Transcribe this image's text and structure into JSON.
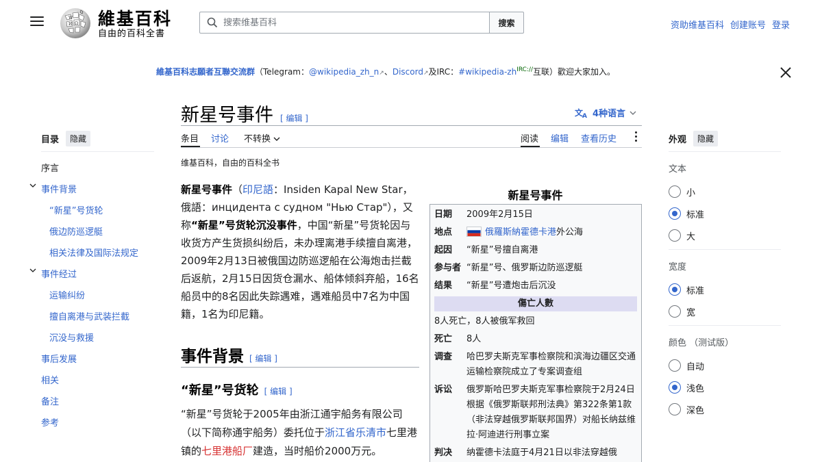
{
  "header": {
    "wordmark": "維基百科",
    "tagline": "自由的百科全書",
    "search_placeholder": "搜索维基百科",
    "search_button": "搜索",
    "user_links": [
      "资助维基百科",
      "创建账号",
      "登录"
    ]
  },
  "sitenotice": {
    "title": "維基百科志願者互聯交流群",
    "open_paren": "（Telegram：",
    "telegram": "@wikipedia_zh_n",
    "sep1": "、",
    "discord": "Discord",
    "sep2": "及IRC：",
    "irc": "#wikipedia-zh",
    "irc_sup": "IRC://",
    "end": "互联）歡迎大家加入。"
  },
  "article": {
    "title": "新星号事件",
    "edit_label": "[ 编辑 ]",
    "languages": "4种语言",
    "tabs": {
      "article": "条目",
      "talk": "讨论",
      "variant": "不转换",
      "read": "阅读",
      "edit": "编辑",
      "history": "查看历史"
    },
    "from": "维基百科，自由的百科全书",
    "lead": {
      "bold_title": "新星号事件",
      "p1": "（",
      "lang1": "印尼語",
      "p2": "：Insiden Kapal New Star，俄語：инцидента с судном \"Нью Стар\"），又称",
      "bold_alt": "“新星”号货轮沉没事件",
      "p3": "，中国“新星”号货轮因与收货方产生货损纠纷后，未办理离港手续擅自离港，2009年2月13日被俄国边防巡逻船在公海炮击拦截后返航，2月15日因货仓漏水、船体倾斜弃船，16名船员中的8名因此失踪遇难，遇难船员中7名为中国籍，1名为印尼籍。"
    },
    "h2_background": "事件背景",
    "h3_ship": "“新星”号货轮",
    "ship_para": {
      "p1": "“新星”号货轮于2005年由浙江通宇船务有限公司（以下简称通宇船务）委托位于",
      "link1": "浙江省乐清市",
      "p2": "七里港镇的",
      "link2": "七里港船厂",
      "p3": "建造，当时船价2000万元。"
    }
  },
  "toc": {
    "title": "目录",
    "hide": "隐藏",
    "items": [
      {
        "label": "序言"
      },
      {
        "label": "事件背景"
      },
      {
        "label": "“新星”号货轮"
      },
      {
        "label": "俄边防巡逻艇"
      },
      {
        "label": "相关法律及国际法规定"
      },
      {
        "label": "事件经过"
      },
      {
        "label": "运输纠纷"
      },
      {
        "label": "擅自离港与武装拦截"
      },
      {
        "label": "沉没与救援"
      },
      {
        "label": "事后发展"
      },
      {
        "label": "相关"
      },
      {
        "label": "备注"
      },
      {
        "label": "参考"
      }
    ]
  },
  "appearance": {
    "title": "外观",
    "hide": "隐藏",
    "text_label": "文本",
    "text_options": [
      "小",
      "标准",
      "大"
    ],
    "text_selected": "标准",
    "width_label": "宽度",
    "width_options": [
      "标准",
      "宽"
    ],
    "width_selected": "标准",
    "color_label": "颜色 （测试版）",
    "color_options": [
      "自动",
      "浅色",
      "深色"
    ],
    "color_selected": "浅色"
  },
  "infobox": {
    "caption": "新星号事件",
    "date_k": "日期",
    "date_v": "2009年2月15日",
    "place_k": "地点",
    "place_link": "俄羅斯納霍德卡港",
    "place_rest": "外公海",
    "cause_k": "起因",
    "cause_v": "“新星”号擅自离港",
    "parties_k": "参与者",
    "parties_v": "“新星”号、俄罗斯边防巡逻艇",
    "result_k": "结果",
    "result_v": "“新星”号遭炮击后沉没",
    "casualties_head": "傷亡人數",
    "casualties_summary": "8人死亡，8人被俄军救回",
    "dead_k": "死亡",
    "dead_v": "8人",
    "investigation_k": "调查",
    "investigation_v": "哈巴罗夫斯克军事检察院和滨海边疆区交通运输检察院成立了专案调查组",
    "prosecution_k": "诉讼",
    "prosecution_v": "俄罗斯哈巴罗夫斯克军事检察院于2月24日根据《俄罗斯联邦刑法典》第322条第1款（非法穿越俄罗斯联邦国界）对船长纳兹维拉·阿迪进行刑事立案",
    "verdict_k": "判决",
    "verdict_v": "纳霍德卡法庭于4月21日以非法穿越俄"
  }
}
